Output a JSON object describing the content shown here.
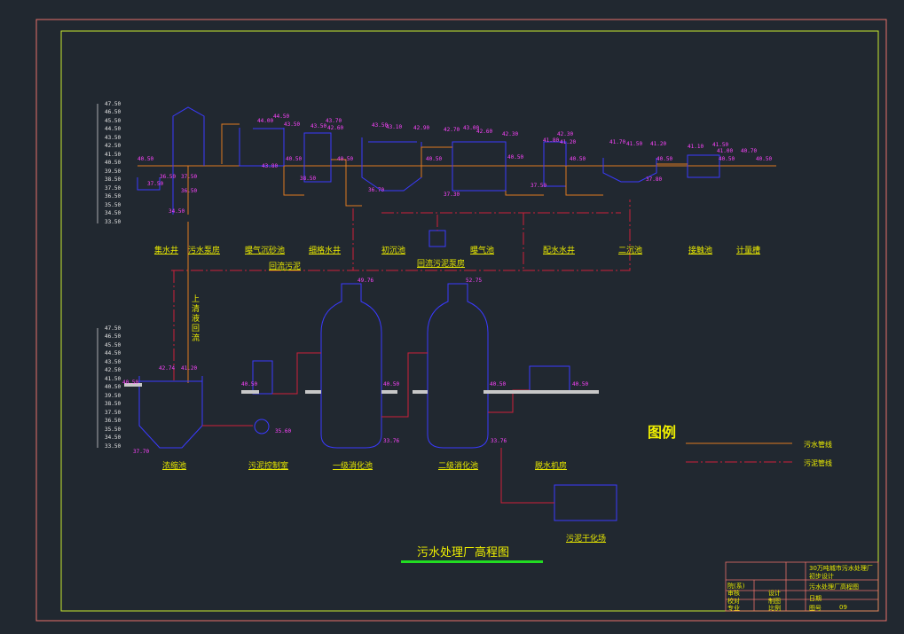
{
  "drawing": {
    "title": "污水处理厂高程图",
    "legend": {
      "title": "图例",
      "items": [
        {
          "label": "污水管线",
          "color": "#e07a20"
        },
        {
          "label": "污泥管线",
          "color": "#d0203a"
        }
      ]
    },
    "colors": {
      "frame_outer": "#e8706a",
      "frame_inner": "#c8e830",
      "structure": "#3a3aff",
      "sewage_line": "#e07a20",
      "sludge_line": "#d0203a",
      "elevation": "#ff44ff",
      "label": "#e8e800",
      "ground": "#c8c8c8",
      "title_bar": "#22dd22"
    }
  },
  "upper_section": {
    "scale_ticks": [
      "47.50",
      "46.50",
      "45.50",
      "44.50",
      "43.50",
      "42.50",
      "41.50",
      "40.50",
      "39.50",
      "38.50",
      "37.50",
      "36.50",
      "35.50",
      "34.50",
      "33.50"
    ],
    "labels": [
      "集水井",
      "污水泵房",
      "曝气沉砂池",
      "细格水井",
      "初沉池",
      "回流污泥泵房",
      "曝气池",
      "配水水井",
      "二沉池",
      "接触池",
      "计量槽"
    ],
    "elevations": [
      "40.50",
      "37.50",
      "36.50",
      "37.50",
      "36.50",
      "34.50",
      "44.00",
      "44.50",
      "43.50",
      "43.80",
      "40.50",
      "38.50",
      "43.70",
      "43.50",
      "42.60",
      "40.50",
      "43.50",
      "43.10",
      "42.90",
      "36.70",
      "40.50",
      "37.30",
      "42.70",
      "43.00",
      "42.60",
      "42.30",
      "40.50",
      "37.50",
      "41.80",
      "42.30",
      "41.20",
      "40.50",
      "37.80",
      "41.70",
      "41.50",
      "41.20",
      "40.50",
      "41.10",
      "41.50",
      "41.00",
      "40.70",
      "40.50",
      "40.50"
    ],
    "return_sludge_label": "回流污泥",
    "sludge_upflow_label": "上清液回流"
  },
  "lower_section": {
    "scale_ticks": [
      "47.50",
      "46.50",
      "45.50",
      "44.50",
      "43.50",
      "42.50",
      "41.50",
      "40.50",
      "39.50",
      "38.50",
      "37.50",
      "36.50",
      "35.50",
      "34.50",
      "33.50"
    ],
    "labels": [
      "浓缩池",
      "污泥控制室",
      "一级消化池",
      "二级消化池",
      "脱水机房",
      "污泥干化场"
    ],
    "elevations": [
      "42.74",
      "41.20",
      "40.50",
      "37.70",
      "40.50",
      "35.60",
      "49.76",
      "40.50",
      "33.76",
      "52.75",
      "40.50",
      "33.76",
      "40.50"
    ]
  },
  "title_block": {
    "project": "30万吨城市污水处理厂初步设计",
    "drawing_name": "污水处理厂高程图",
    "fields": [
      {
        "label": "设计",
        "value": ""
      },
      {
        "label": "制图",
        "value": ""
      },
      {
        "label": "审核",
        "value": ""
      },
      {
        "label": "校对",
        "value": ""
      },
      {
        "label": "专业",
        "value": ""
      },
      {
        "label": "比例",
        "value": ""
      }
    ],
    "header_left": "院(系)",
    "date_label": "日期",
    "number_label": "图号",
    "number_value": "09"
  }
}
